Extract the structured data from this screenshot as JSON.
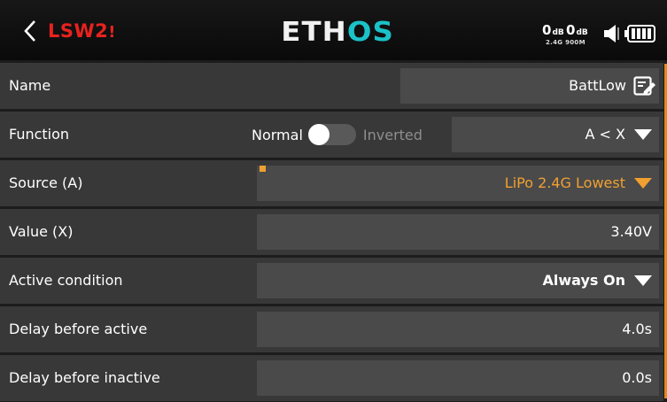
{
  "header": {
    "title": "LSW2",
    "title_marker": "!",
    "logo_prefix": "ETH",
    "logo_accent": "OS",
    "rssi_a": {
      "value": "0",
      "unit": "dB"
    },
    "rssi_b": {
      "value": "0",
      "unit": "dB"
    },
    "band_label": "2.4G 900M",
    "icons": [
      "back-chevron-icon",
      "speaker-icon",
      "battery-icon"
    ],
    "colors": {
      "title": "#e8221e",
      "logo_accent": "#1bc2c8",
      "accent_orange": "#f0a030"
    }
  },
  "rows": {
    "name": {
      "label": "Name",
      "value": "BattLow",
      "icon": "edit-icon"
    },
    "function": {
      "label": "Function",
      "toggle_left": "Normal",
      "toggle_right": "Inverted",
      "toggle_state": "Normal",
      "value": "A < X"
    },
    "source": {
      "label": "Source (A)",
      "value": "LiPo 2.4G Lowest"
    },
    "value": {
      "label": "Value (X)",
      "value": "3.40V"
    },
    "active_condition": {
      "label": "Active condition",
      "value": "Always On"
    },
    "delay_active": {
      "label": "Delay before active",
      "value": "4.0s"
    },
    "delay_inactive": {
      "label": "Delay before inactive",
      "value": "0.0s"
    }
  }
}
